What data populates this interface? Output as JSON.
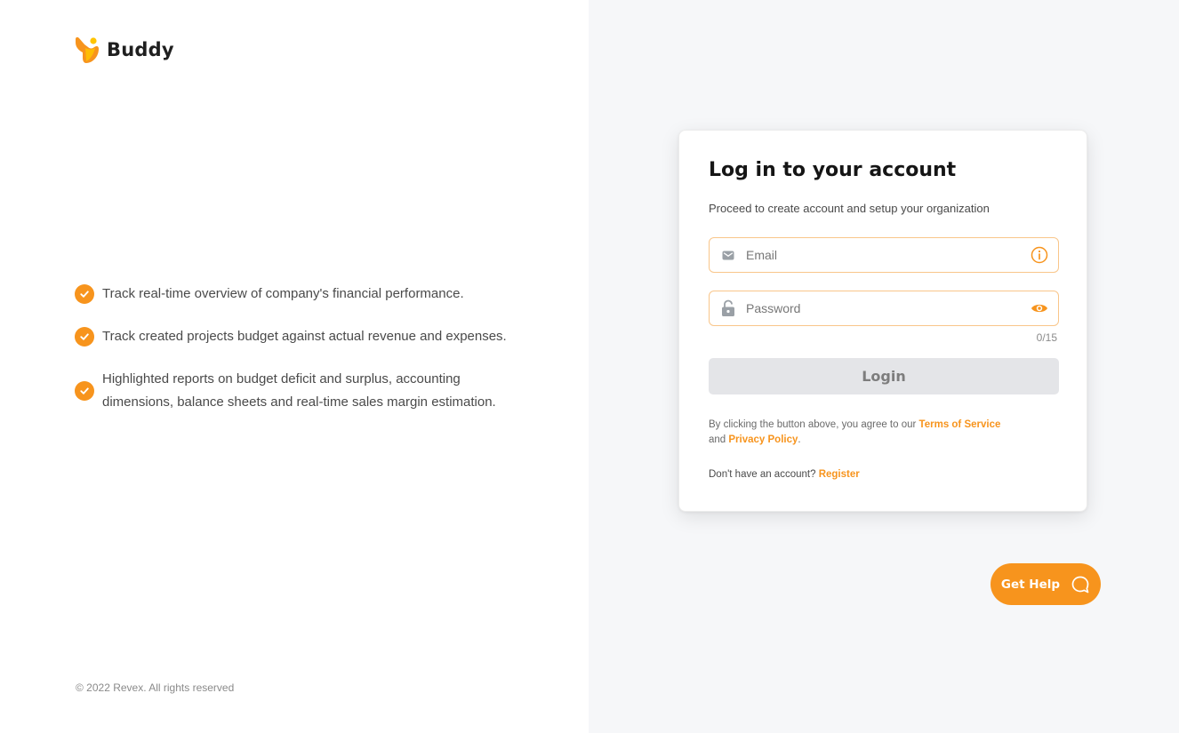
{
  "brand": {
    "name": "Buddy",
    "logo_icon": "buddy-logo-icon",
    "logo_colors": [
      "#f7941d",
      "#ffc400"
    ]
  },
  "features": [
    {
      "icon": "check-circle-icon",
      "text": "Track real-time overview of company's financial performance."
    },
    {
      "icon": "check-circle-icon",
      "text": "Track created projects budget against actual revenue and expenses."
    },
    {
      "icon": "check-circle-icon",
      "text": "Highlighted reports on budget deficit and surplus, accounting dimensions, balance sheets and real-time sales margin estimation."
    }
  ],
  "footer": {
    "copyright": "© 2022 Revex. All rights reserved"
  },
  "login_card": {
    "title": "Log in to your account",
    "subtitle": "Proceed to create account and setup your organization",
    "email": {
      "placeholder": "Email",
      "value": "",
      "lead_icon": "mail-icon",
      "trail_icon": "info-icon"
    },
    "password": {
      "placeholder": "Password",
      "value": "",
      "lead_icon": "lock-icon",
      "trail_icon": "eye-icon",
      "counter": "0/15"
    },
    "login_button": "Login",
    "terms": {
      "prefix": "By clicking the button above, you agree to our",
      "terms_link": "Terms of Service",
      "conjunction": "and",
      "privacy_link": "Privacy Policy",
      "suffix": "."
    },
    "signup": {
      "prompt": "Don't have an account?",
      "link": "Register"
    }
  },
  "help": {
    "label": "Get Help",
    "icon": "chat-bubble-icon"
  },
  "colors": {
    "accent": "#f7941d",
    "field_border": "#f9c68a",
    "button_disabled": "#e4e5e8",
    "right_panel_bg": "#f6f7f9"
  }
}
